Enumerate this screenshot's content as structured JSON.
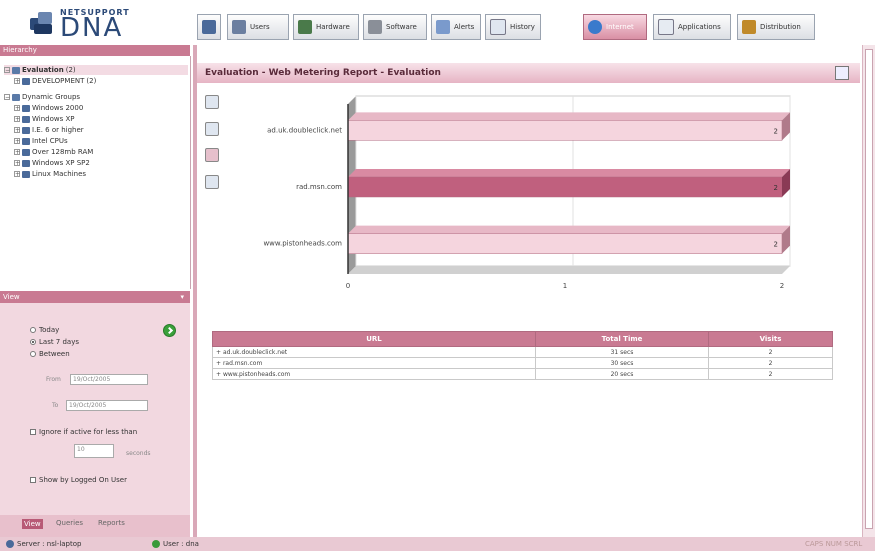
{
  "brand": {
    "top": "NETSUPPORT",
    "main": "DNA"
  },
  "toolbar": {
    "tabs": [
      {
        "label": "",
        "icon": "home-icon"
      },
      {
        "label": "Users",
        "icon": "users-icon"
      },
      {
        "label": "Hardware",
        "icon": "hardware-icon"
      },
      {
        "label": "Software",
        "icon": "software-icon"
      },
      {
        "label": "Alerts",
        "icon": "alerts-icon"
      },
      {
        "label": "History",
        "icon": "history-icon"
      },
      {
        "label": "Internet",
        "icon": "globe-icon"
      },
      {
        "label": "Applications",
        "icon": "applications-icon"
      },
      {
        "label": "Distribution",
        "icon": "distribution-icon"
      }
    ],
    "active": "Internet"
  },
  "hierarchy": {
    "header": "Hierarchy",
    "nodes": [
      {
        "label": "Evaluation",
        "count": "(2)",
        "level": 0,
        "selected": true
      },
      {
        "label": "DEVELOPMENT",
        "count": "(2)",
        "level": 1
      },
      {
        "label": "Dynamic Groups",
        "count": "",
        "level": 0
      },
      {
        "label": "Windows 2000",
        "count": "",
        "level": 1
      },
      {
        "label": "Windows XP",
        "count": "",
        "level": 1
      },
      {
        "label": "I.E. 6 or higher",
        "count": "",
        "level": 1
      },
      {
        "label": "Intel CPUs",
        "count": "",
        "level": 1
      },
      {
        "label": "Over 128mb RAM",
        "count": "",
        "level": 1
      },
      {
        "label": "Windows XP SP2",
        "count": "",
        "level": 1
      },
      {
        "label": "Linux Machines",
        "count": "",
        "level": 1
      }
    ]
  },
  "view": {
    "header": "View",
    "options": [
      "Today",
      "Last 7 days",
      "Between"
    ],
    "selected": "Last 7 days",
    "from_label": "From",
    "from_value": "19/Oct/2005",
    "to_label": "To",
    "to_value": "19/Oct/2005",
    "ignore_label": "Ignore if active for less than",
    "ignore_value": "10",
    "seconds_label": "seconds",
    "logged_label": "Show by Logged On User"
  },
  "bottom_tabs": [
    "View",
    "Queries",
    "Reports"
  ],
  "status": {
    "server": "Server : nsl-laptop",
    "user": "User : dna",
    "right": "CAPS NUM SCRL"
  },
  "report": {
    "title": "Evaluation - Web Metering Report - Evaluation"
  },
  "chart_data": {
    "type": "bar",
    "orientation": "horizontal",
    "categories": [
      "ad.uk.doubleclick.net",
      "rad.msn.com",
      "www.pistonheads.com"
    ],
    "values": [
      2,
      2,
      2
    ],
    "data_labels": [
      "2",
      "2",
      "2"
    ],
    "xlim": [
      0,
      2
    ],
    "xticks": [
      "0",
      "1",
      "2"
    ],
    "colors": [
      "#f5d5de",
      "#c0607e",
      "#f5d5de"
    ]
  },
  "table": {
    "headers": [
      "URL",
      "Total Time",
      "Visits"
    ],
    "rows": [
      {
        "url": "ad.uk.doubleclick.net",
        "time": "31 secs",
        "visits": "2"
      },
      {
        "url": "rad.msn.com",
        "time": "30 secs",
        "visits": "2"
      },
      {
        "url": "www.pistonheads.com",
        "time": "20 secs",
        "visits": "2"
      }
    ]
  },
  "colors": {
    "accent": "#c97a92",
    "panel": "#f2d8e0",
    "title_text": "#5a2a3a"
  }
}
